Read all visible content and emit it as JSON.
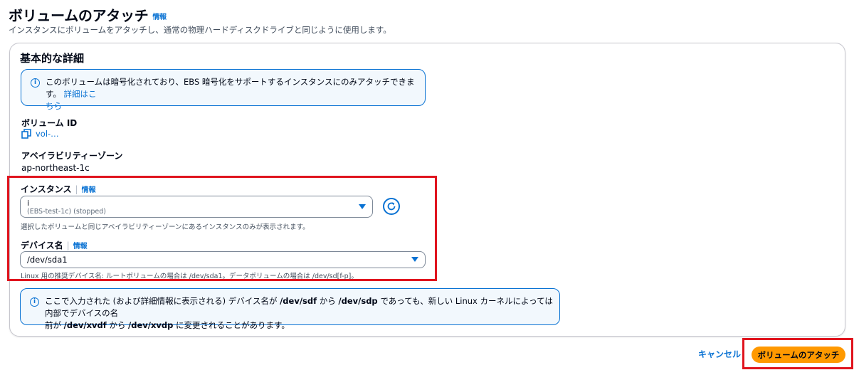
{
  "header": {
    "title": "ボリュームのアタッチ",
    "info": "情報",
    "description": "インスタンスにボリュームをアタッチし、通常の物理ハードディスクドライブと同じように使用します。"
  },
  "panel": {
    "title": "基本的な詳細",
    "encryption_alert": {
      "text": "このボリュームは暗号化されており、EBS 暗号化をサポートするインスタンスにのみアタッチできます。",
      "link_line1": "詳細はこ",
      "link_line2": "ちら"
    },
    "volume_id": {
      "label": "ボリューム ID",
      "value": "vol-…"
    },
    "availability_zone": {
      "label": "アベイラビリティーゾーン",
      "value": "ap-northeast-1c"
    },
    "instance": {
      "label": "インスタンス",
      "info": "情報",
      "selected_id": "i",
      "selected_desc": "(EBS-test-1c) (stopped)",
      "hint": "選択したボリュームと同じアベイラビリティーゾーンにあるインスタンスのみが表示されます。"
    },
    "device": {
      "label": "デバイス名",
      "info": "情報",
      "value": "/dev/sda1",
      "hint": "Linux 用の推奨デバイス名: ルートボリュームの場合は /dev/sda1。データボリュームの場合は /dev/sd[f-p]。"
    },
    "device_alert": {
      "p1": "ここで入力された (および詳細情報に表示される) デバイス名が ",
      "b1": "/dev/sdf",
      "p2": " から ",
      "b2": "/dev/sdp",
      "p3": " であっても、新しい Linux カーネルによっては内部でデバイスの名",
      "p4": "前が ",
      "b3": "/dev/xvdf",
      "p5": " から ",
      "b4": "/dev/xvdp",
      "p6": " に変更されることがあります。"
    }
  },
  "footer": {
    "cancel": "キャンセル",
    "attach": "ボリュームのアタッチ"
  },
  "colors": {
    "link": "#0972d3",
    "primary": "#ff9900",
    "highlight": "#e0141e",
    "alert_bg": "#f2f8fd"
  }
}
